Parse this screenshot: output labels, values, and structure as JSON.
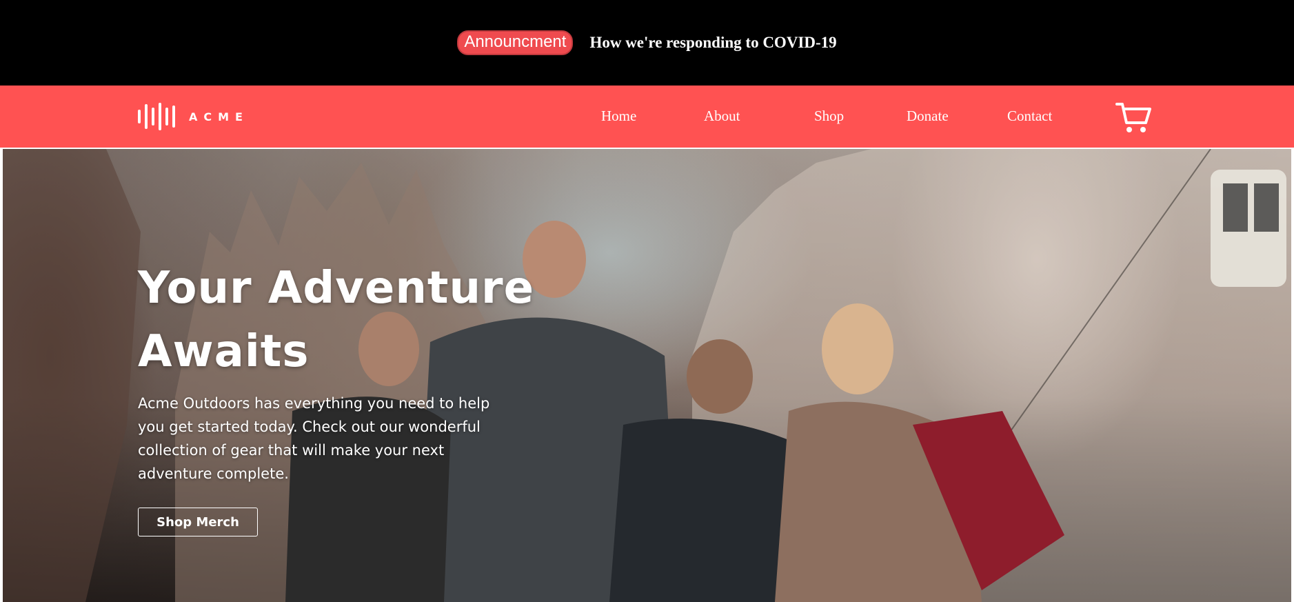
{
  "announcement": {
    "badge": "Announcment",
    "text": "How we're responding to COVID-19",
    "colors": {
      "background": "#000000",
      "badge": "#ef4b4f"
    }
  },
  "nav": {
    "logo_text": "ACME",
    "links": [
      "Home",
      "About",
      "Shop",
      "Donate",
      "Contact"
    ],
    "cart_icon": "cart-icon",
    "colors": {
      "background": "#ff5252",
      "text": "#ffffff"
    }
  },
  "hero": {
    "title_line1": "Your Adventure",
    "title_line2": "Awaits",
    "description": "Acme Outdoors has everything you need to help you get started today. Check out our wonderful collection of gear that will make your next adventure complete.",
    "button_label": "Shop Merch",
    "image_icon": "hero-photo"
  }
}
